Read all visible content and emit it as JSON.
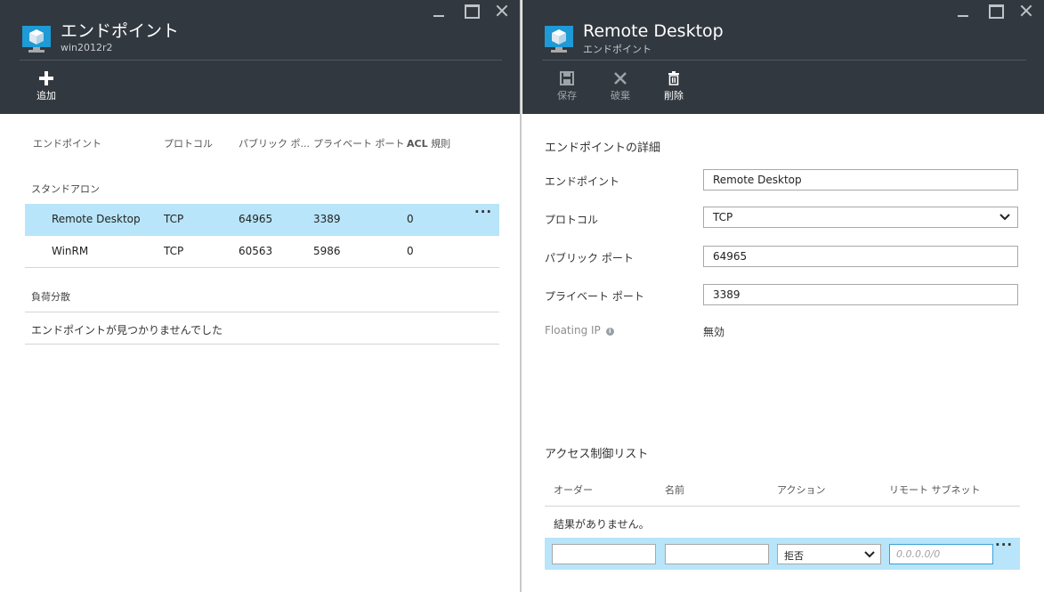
{
  "left": {
    "title": "エンドポイント",
    "subtitle": "win2012r2",
    "add_label": "追加",
    "columns": [
      "エンドポイント",
      "プロトコル",
      "パブリック ポ...",
      "プライベート ポート",
      "ACL",
      "規則"
    ],
    "standalone_label": "スタンドアロン",
    "rows": [
      {
        "name": "Remote Desktop",
        "protocol": "TCP",
        "public": "64965",
        "private": "3389",
        "acl": "0"
      },
      {
        "name": "WinRM",
        "protocol": "TCP",
        "public": "60563",
        "private": "5986",
        "acl": "0"
      }
    ],
    "more_label": "···",
    "lb_label": "負荷分散",
    "lb_empty": "エンドポイントが見つかりませんでした"
  },
  "right": {
    "title": "Remote Desktop",
    "subtitle": "エンドポイント",
    "commands": {
      "save": "保存",
      "discard": "破棄",
      "delete": "削除"
    },
    "details_title": "エンドポイントの詳細",
    "fields": {
      "endpoint_label": "エンドポイント",
      "endpoint_value": "Remote Desktop",
      "protocol_label": "プロトコル",
      "protocol_value": "TCP",
      "public_label": "パブリック ポート",
      "public_value": "64965",
      "private_label": "プライベート ポート",
      "private_value": "3389",
      "floating_label": "Floating IP",
      "floating_value": "無効"
    },
    "acl": {
      "title": "アクセス制御リスト",
      "columns": [
        "オーダー",
        "名前",
        "アクション",
        "リモート サブネット"
      ],
      "empty": "結果がありません。",
      "action_value": "拒否",
      "subnet_placeholder": "0.0.0.0/0",
      "more_label": "···"
    }
  },
  "colors": {
    "header": "#32383f",
    "selected": "#b8e5f9",
    "tile": "#1e9ad6"
  },
  "icons": [
    "vm-cube-icon",
    "plus-icon",
    "save-icon",
    "discard-icon",
    "delete-icon",
    "minimize-icon",
    "maximize-icon",
    "close-icon",
    "chevron-down-icon",
    "info-icon"
  ]
}
